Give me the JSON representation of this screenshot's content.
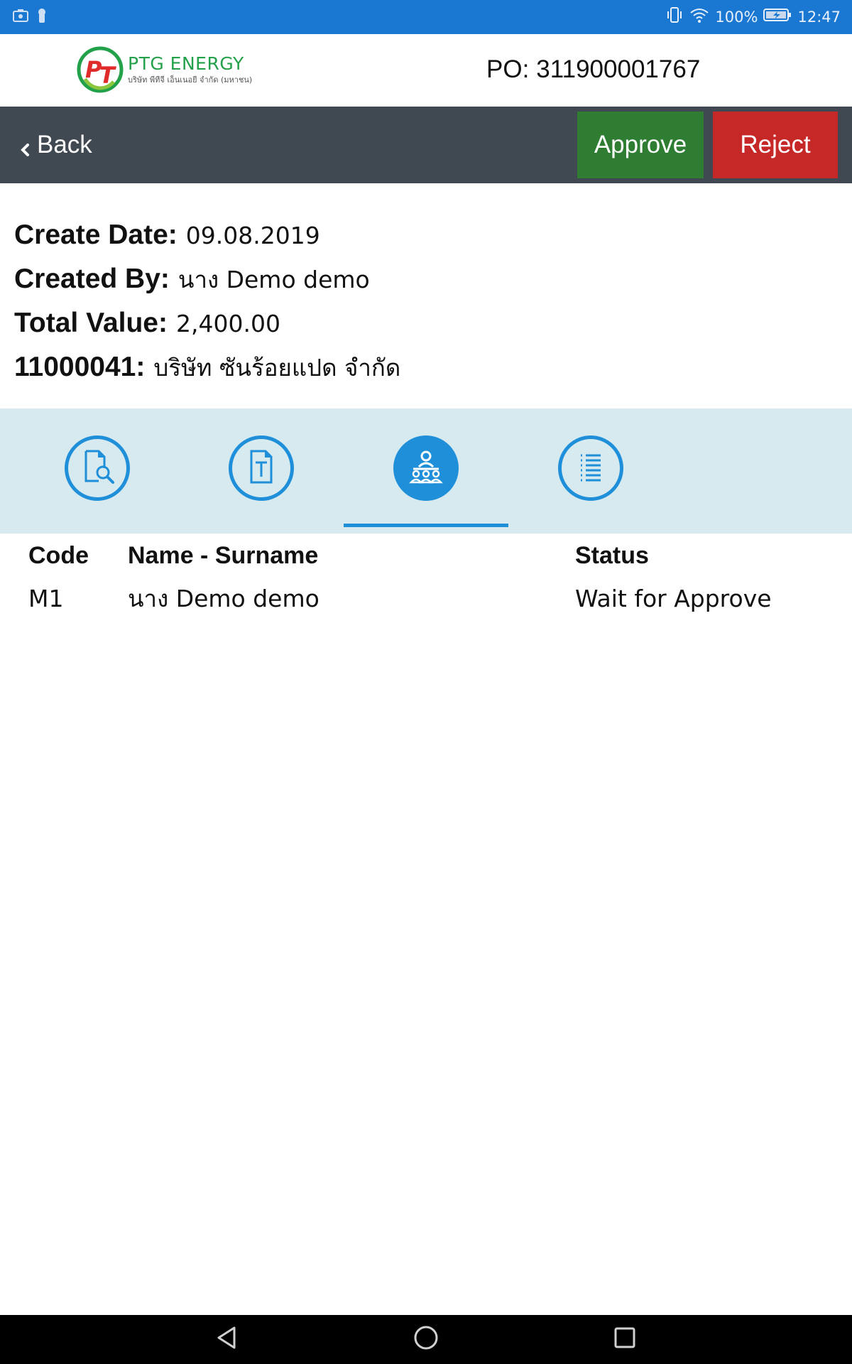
{
  "status_bar": {
    "battery": "100%",
    "time": "12:47"
  },
  "header": {
    "logo_name": "PTG ENERGY",
    "logo_subtitle": "บริษัท พีทีจี เอ็นเนอยี จำกัด (มหาชน)",
    "po_label": "PO:",
    "po_number": "311900001767"
  },
  "toolbar": {
    "back_label": "Back",
    "approve_label": "Approve",
    "reject_label": "Reject"
  },
  "summary": {
    "create_date_label": "Create Date:",
    "create_date": "09.08.2019",
    "created_by_label": "Created By:",
    "created_by": "นาง Demo demo",
    "total_value_label": "Total Value:",
    "total_value": "2,400.00",
    "vendor_code_label": "11000041:",
    "vendor_name": "บริษัท ซันร้อยแปด จำกัด"
  },
  "tabs": [
    {
      "icon": "document-search-icon",
      "active": false
    },
    {
      "icon": "text-document-icon",
      "active": false
    },
    {
      "icon": "approvers-group-icon",
      "active": true
    },
    {
      "icon": "list-icon",
      "active": false
    }
  ],
  "approvers": {
    "headers": {
      "code": "Code",
      "name": "Name - Surname",
      "status": "Status"
    },
    "rows": [
      {
        "code": "M1",
        "name": "นาง Demo demo",
        "status": "Wait for Approve"
      }
    ]
  },
  "colors": {
    "status_bar": "#1b78d2",
    "toolbar": "#404852",
    "approve": "#2e7d32",
    "reject": "#c62828",
    "tab_strip": "#d7eaf0",
    "tab_accent": "#1e8fd8",
    "brand_green": "#23a14a",
    "brand_red": "#e02b2b"
  }
}
